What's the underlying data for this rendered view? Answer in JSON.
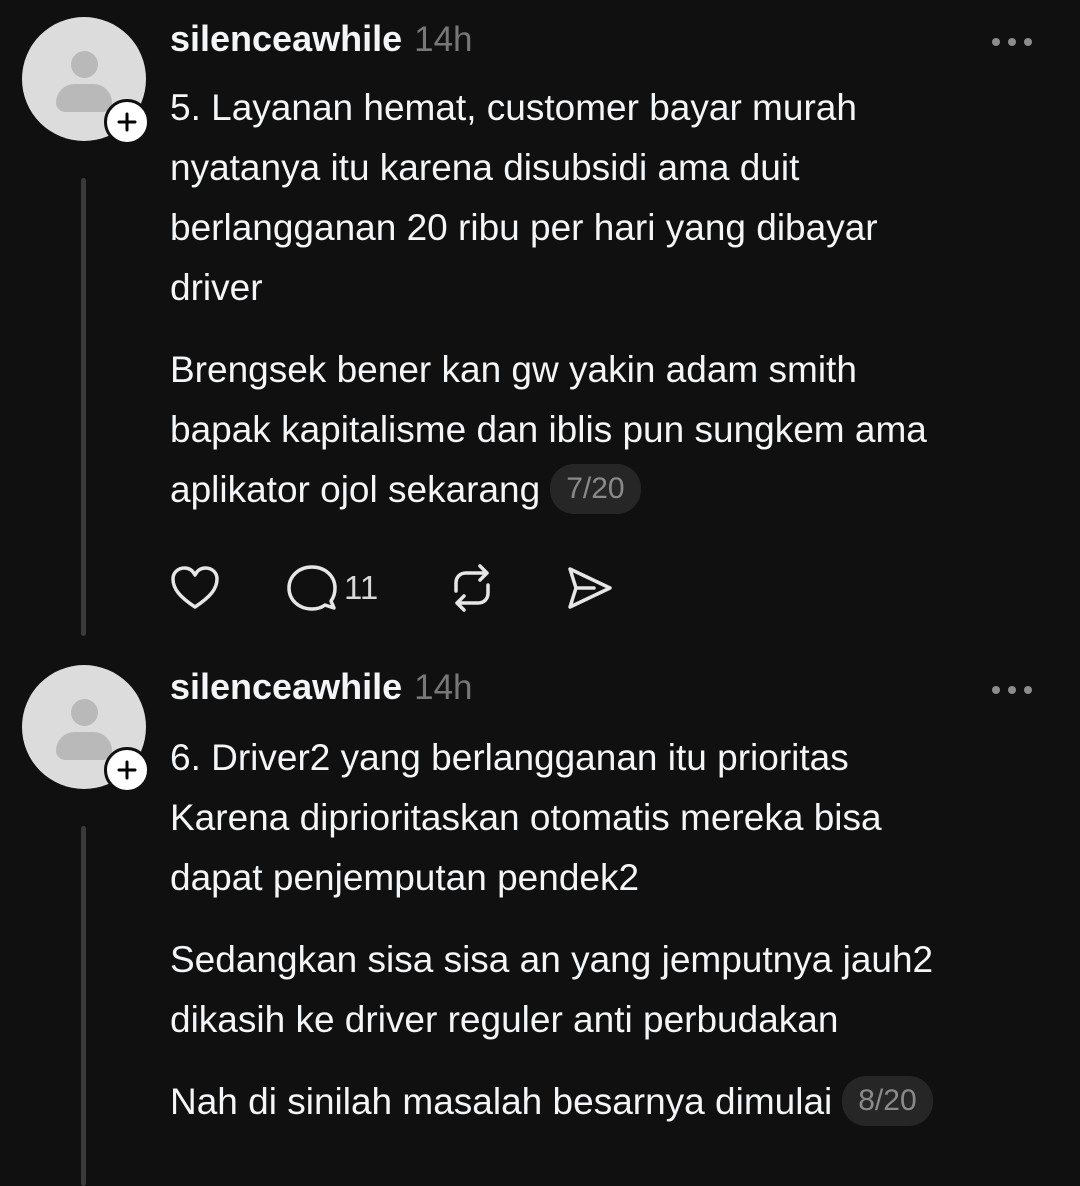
{
  "posts": [
    {
      "username": "silenceawhile",
      "time": "14h",
      "paragraphs": [
        "5. Layanan hemat, customer bayar murah\nnyatanya itu karena disubsidi ama duit\nberlangganan 20 ribu per hari yang dibayar\ndriver",
        "Brengsek bener kan gw yakin adam smith\nbapak kapitalisme dan iblis pun sungkem ama\naplikator ojol sekarang"
      ],
      "counter": "7/20",
      "reply_count": "11"
    },
    {
      "username": "silenceawhile",
      "time": "14h",
      "paragraphs": [
        "6. Driver2 yang berlangganan itu prioritas\nKarena diprioritaskan otomatis mereka bisa\ndapat penjemputan pendek2",
        "Sedangkan sisa sisa an yang jemputnya jauh2\ndikasih ke driver reguler anti perbudakan",
        "Nah di sinilah masalah besarnya dimulai"
      ],
      "counter": "8/20"
    }
  ],
  "icons": {
    "avatar": "default-user-avatar",
    "follow": "plus-icon",
    "more": "more-horizontal-icon",
    "like": "heart-icon",
    "reply": "comment-bubble-icon",
    "repost": "repost-icon",
    "share": "send-icon"
  }
}
